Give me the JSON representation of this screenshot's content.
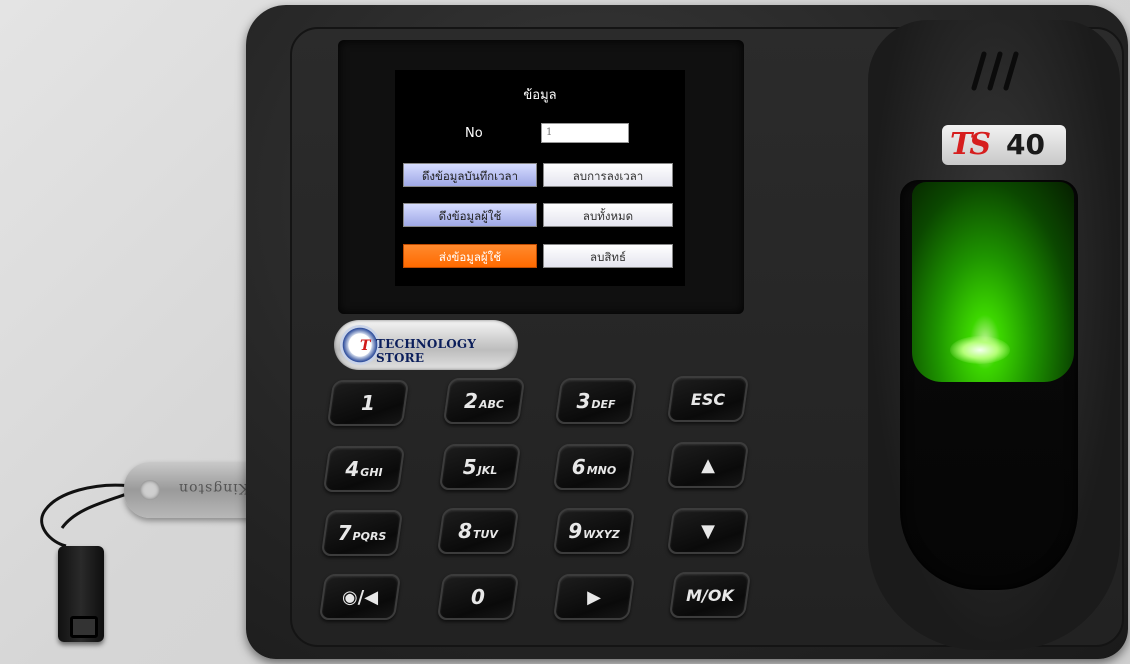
{
  "screen": {
    "title": "ข้อมูล",
    "field_label": "No",
    "field_value": "1",
    "buttons": [
      {
        "label": "ดึงข้อมูลบันทึกเวลา",
        "style": "blue"
      },
      {
        "label": "ลบการลงเวลา",
        "style": "white"
      },
      {
        "label": "ดึงข้อมูลผู้ใช้",
        "style": "blue"
      },
      {
        "label": "ลบทั้งหมด",
        "style": "white"
      },
      {
        "label": "ส่งข้อมูลผู้ใช้",
        "style": "selected"
      },
      {
        "label": "ลบสิทธ์",
        "style": "white"
      }
    ]
  },
  "logo": {
    "text": "TECHNOLOGY STORE"
  },
  "brand": {
    "model_prefix": "TS",
    "model_number": "40"
  },
  "usb": {
    "text": "Kingston"
  },
  "keypad": {
    "k1": {
      "main": "1",
      "sub": ""
    },
    "k2": {
      "main": "2",
      "sub": "ABC"
    },
    "k3": {
      "main": "3",
      "sub": "DEF"
    },
    "esc": {
      "main": "ESC"
    },
    "k4": {
      "main": "4",
      "sub": "GHI"
    },
    "k5": {
      "main": "5",
      "sub": "JKL"
    },
    "k6": {
      "main": "6",
      "sub": "MNO"
    },
    "up": {
      "symbol": "▲"
    },
    "k7": {
      "main": "7",
      "sub": "PQRS"
    },
    "k8": {
      "main": "8",
      "sub": "TUV"
    },
    "k9": {
      "main": "9",
      "sub": "WXYZ"
    },
    "down": {
      "symbol": "▼"
    },
    "power": {
      "symbol": "◉/◀"
    },
    "k0": {
      "main": "0"
    },
    "right": {
      "symbol": "▶"
    },
    "ok": {
      "main": "M/OK"
    }
  },
  "colors": {
    "selected": "#ff6a00",
    "glow": "#3fe000",
    "brand_red": "#d61e1e"
  }
}
